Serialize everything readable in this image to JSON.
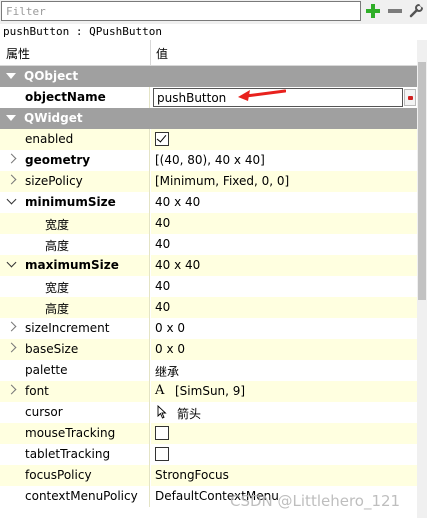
{
  "filter": {
    "placeholder": "Filter"
  },
  "toolbar": {
    "add_icon": "plus-icon",
    "remove_icon": "minus-icon",
    "config_icon": "wrench-icon"
  },
  "object_class_label": "pushButton : QPushButton",
  "header": {
    "property": "属性",
    "value": "值"
  },
  "groups": {
    "qobject": "QObject",
    "qwidget": "QWidget"
  },
  "rows": {
    "objectName": {
      "label": "objectName",
      "value": "pushButton"
    },
    "enabled": {
      "label": "enabled",
      "checked": true
    },
    "geometry": {
      "label": "geometry",
      "value": "[(40, 80), 40 x 40]"
    },
    "sizePolicy": {
      "label": "sizePolicy",
      "value": "[Minimum, Fixed, 0, 0]"
    },
    "minimumSize": {
      "label": "minimumSize",
      "value": "40 x 40"
    },
    "min_width": {
      "label": "宽度",
      "value": "40"
    },
    "min_height": {
      "label": "高度",
      "value": "40"
    },
    "maximumSize": {
      "label": "maximumSize",
      "value": "40 x 40"
    },
    "max_width": {
      "label": "宽度",
      "value": "40"
    },
    "max_height": {
      "label": "高度",
      "value": "40"
    },
    "sizeIncrement": {
      "label": "sizeIncrement",
      "value": "0 x 0"
    },
    "baseSize": {
      "label": "baseSize",
      "value": "0 x 0"
    },
    "palette": {
      "label": "palette",
      "value": "继承"
    },
    "font": {
      "label": "font",
      "glyph": "A",
      "value": "[SimSun, 9]"
    },
    "cursor": {
      "label": "cursor",
      "value": "箭头"
    },
    "mouseTracking": {
      "label": "mouseTracking",
      "checked": false
    },
    "tabletTracking": {
      "label": "tabletTracking",
      "checked": false
    },
    "focusPolicy": {
      "label": "focusPolicy",
      "value": "StrongFocus"
    },
    "contextMenuPolicy": {
      "label": "contextMenuPolicy",
      "value": "DefaultContextMenu"
    }
  },
  "watermark": "CSDN @Littlehero_121",
  "colors": {
    "group_bg": "#a0a0a0",
    "row_light": "#ffffe0",
    "annotation_arrow": "#e8211d"
  }
}
